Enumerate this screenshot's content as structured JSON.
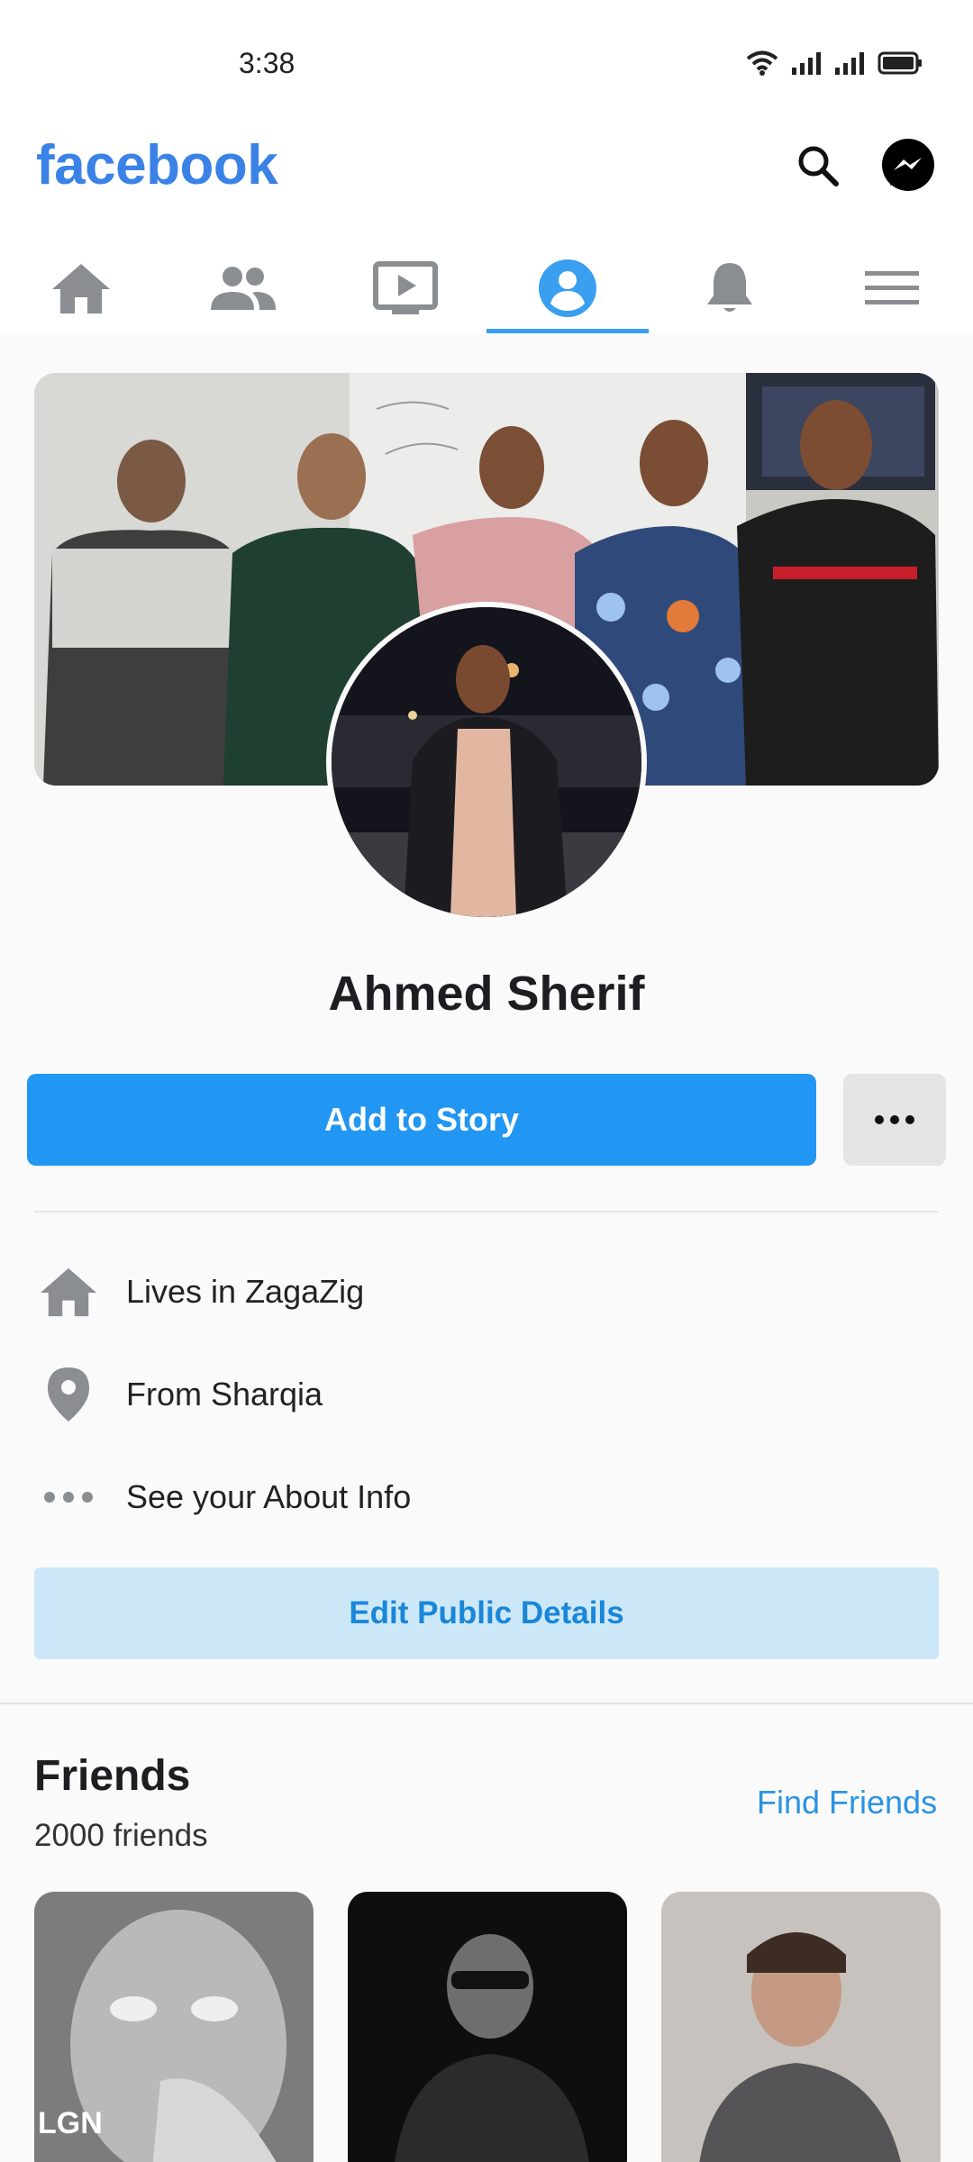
{
  "status_bar": {
    "time": "3:38"
  },
  "header": {
    "brand": "facebook",
    "brand_color": "#3b82e6",
    "actions": [
      "search-icon",
      "messenger-icon"
    ]
  },
  "nav": {
    "tabs": [
      {
        "icon": "home-icon"
      },
      {
        "icon": "friends-icon"
      },
      {
        "icon": "watch-icon"
      },
      {
        "icon": "profile-icon",
        "active": true
      },
      {
        "icon": "bell-icon"
      },
      {
        "icon": "menu-icon"
      }
    ]
  },
  "profile": {
    "name": "Ahmed Sherif",
    "add_story_label": "Add to Story",
    "more_icon": "more-horizontal-icon"
  },
  "about": {
    "items": [
      {
        "icon": "home-icon",
        "text": "Lives in ZagaZig"
      },
      {
        "icon": "location-pin-icon",
        "text": "From Sharqia"
      },
      {
        "icon": "more-dots-icon",
        "text": "See your About Info"
      }
    ],
    "edit_label": "Edit Public Details"
  },
  "friends": {
    "title": "Friends",
    "count": "2000 friends",
    "find_label": "Find Friends",
    "tile_caption": "LGN"
  },
  "colors": {
    "primary": "#2196f3",
    "light_button": "#cce8f8",
    "link": "#2b93e0",
    "icon_gray": "#8a8d91"
  }
}
